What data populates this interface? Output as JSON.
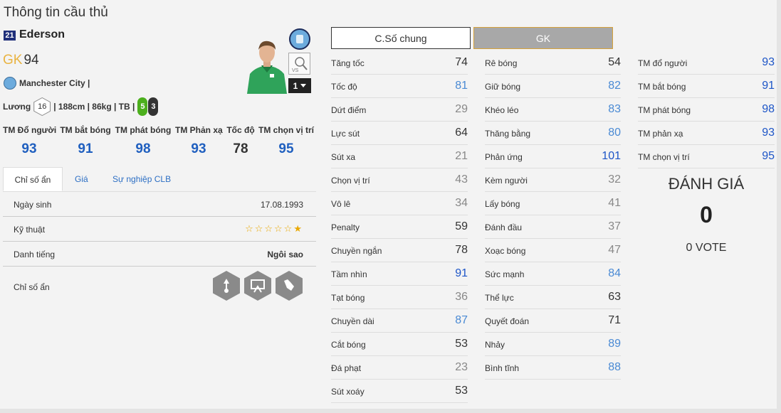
{
  "page_title": "Thông tin cầu thủ",
  "player": {
    "number": "21",
    "name": "Ederson",
    "position": "GK",
    "overall": "94",
    "club": "Manchester City |",
    "salary_label": "Lương",
    "salary": "16",
    "details": "| 188cm | 86kg | TB |",
    "left_foot": "5",
    "right_foot": "3",
    "level": "1"
  },
  "gk_summary": [
    {
      "label": "TM Đổ người",
      "value": "93",
      "color": "blue"
    },
    {
      "label": "TM bắt bóng",
      "value": "91",
      "color": "blue"
    },
    {
      "label": "TM phát bóng",
      "value": "98",
      "color": "blue"
    },
    {
      "label": "TM Phản xạ",
      "value": "93",
      "color": "blue"
    },
    {
      "label": "Tốc độ",
      "value": "78",
      "color": "dark"
    },
    {
      "label": "TM chọn vị trí",
      "value": "95",
      "color": "blue"
    }
  ],
  "tabs": [
    {
      "label": "Chỉ số ẩn"
    },
    {
      "label": "Giá"
    },
    {
      "label": "Sự nghiệp CLB"
    }
  ],
  "info": {
    "birth_label": "Ngày sinh",
    "birth_value": "17.08.1993",
    "skill_label": "Kỹ thuật",
    "skill_stars_empty": "☆☆☆☆☆",
    "skill_stars_filled": "★",
    "fame_label": "Danh tiếng",
    "fame_value": "Ngôi sao",
    "hidden_label": "Chỉ số ẩn"
  },
  "traits": [
    "goalkeeper-long-throw-icon",
    "goalkeeper-box-icon",
    "goalkeeper-glove-icon"
  ],
  "toggles": {
    "general": "C.Số chung",
    "gk": "GK"
  },
  "col1": [
    {
      "name": "Tăng tốc",
      "value": "74",
      "color": "dark"
    },
    {
      "name": "Tốc độ",
      "value": "81",
      "color": "lblue"
    },
    {
      "name": "Dứt điểm",
      "value": "29",
      "color": "gray"
    },
    {
      "name": "Lực sút",
      "value": "64",
      "color": "dark"
    },
    {
      "name": "Sút xa",
      "value": "21",
      "color": "gray"
    },
    {
      "name": "Chọn vị trí",
      "value": "43",
      "color": "gray"
    },
    {
      "name": "Vô lê",
      "value": "34",
      "color": "gray"
    },
    {
      "name": "Penalty",
      "value": "59",
      "color": "dark"
    },
    {
      "name": "Chuyền ngắn",
      "value": "78",
      "color": "dark"
    },
    {
      "name": "Tầm nhìn",
      "value": "91",
      "color": "blue"
    },
    {
      "name": "Tạt bóng",
      "value": "36",
      "color": "gray"
    },
    {
      "name": "Chuyền dài",
      "value": "87",
      "color": "lblue"
    },
    {
      "name": "Cắt bóng",
      "value": "53",
      "color": "dark"
    },
    {
      "name": "Đá phạt",
      "value": "23",
      "color": "gray"
    },
    {
      "name": "Sút xoáy",
      "value": "53",
      "color": "dark"
    }
  ],
  "col2": [
    {
      "name": "Rê bóng",
      "value": "54",
      "color": "dark"
    },
    {
      "name": "Giữ bóng",
      "value": "82",
      "color": "lblue"
    },
    {
      "name": "Khéo léo",
      "value": "83",
      "color": "lblue"
    },
    {
      "name": "Thăng bằng",
      "value": "80",
      "color": "lblue"
    },
    {
      "name": "Phản ứng",
      "value": "101",
      "color": "blue"
    },
    {
      "name": "Kèm người",
      "value": "32",
      "color": "gray"
    },
    {
      "name": "Lấy bóng",
      "value": "41",
      "color": "gray"
    },
    {
      "name": "Đánh đầu",
      "value": "37",
      "color": "gray"
    },
    {
      "name": "Xoạc bóng",
      "value": "47",
      "color": "gray"
    },
    {
      "name": "Sức mạnh",
      "value": "84",
      "color": "lblue"
    },
    {
      "name": "Thể lực",
      "value": "63",
      "color": "dark"
    },
    {
      "name": "Quyết đoán",
      "value": "71",
      "color": "dark"
    },
    {
      "name": "Nhảy",
      "value": "89",
      "color": "lblue"
    },
    {
      "name": "Bình tĩnh",
      "value": "88",
      "color": "lblue"
    }
  ],
  "col3": [
    {
      "name": "TM đổ người",
      "value": "93",
      "color": "blue"
    },
    {
      "name": "TM bắt bóng",
      "value": "91",
      "color": "blue"
    },
    {
      "name": "TM phát bóng",
      "value": "98",
      "color": "blue"
    },
    {
      "name": "TM phản xạ",
      "value": "93",
      "color": "blue"
    },
    {
      "name": "TM chọn vị trí",
      "value": "95",
      "color": "blue"
    }
  ],
  "rating": {
    "title": "ĐÁNH GIÁ",
    "score": "0",
    "votes": "0 VOTE"
  }
}
